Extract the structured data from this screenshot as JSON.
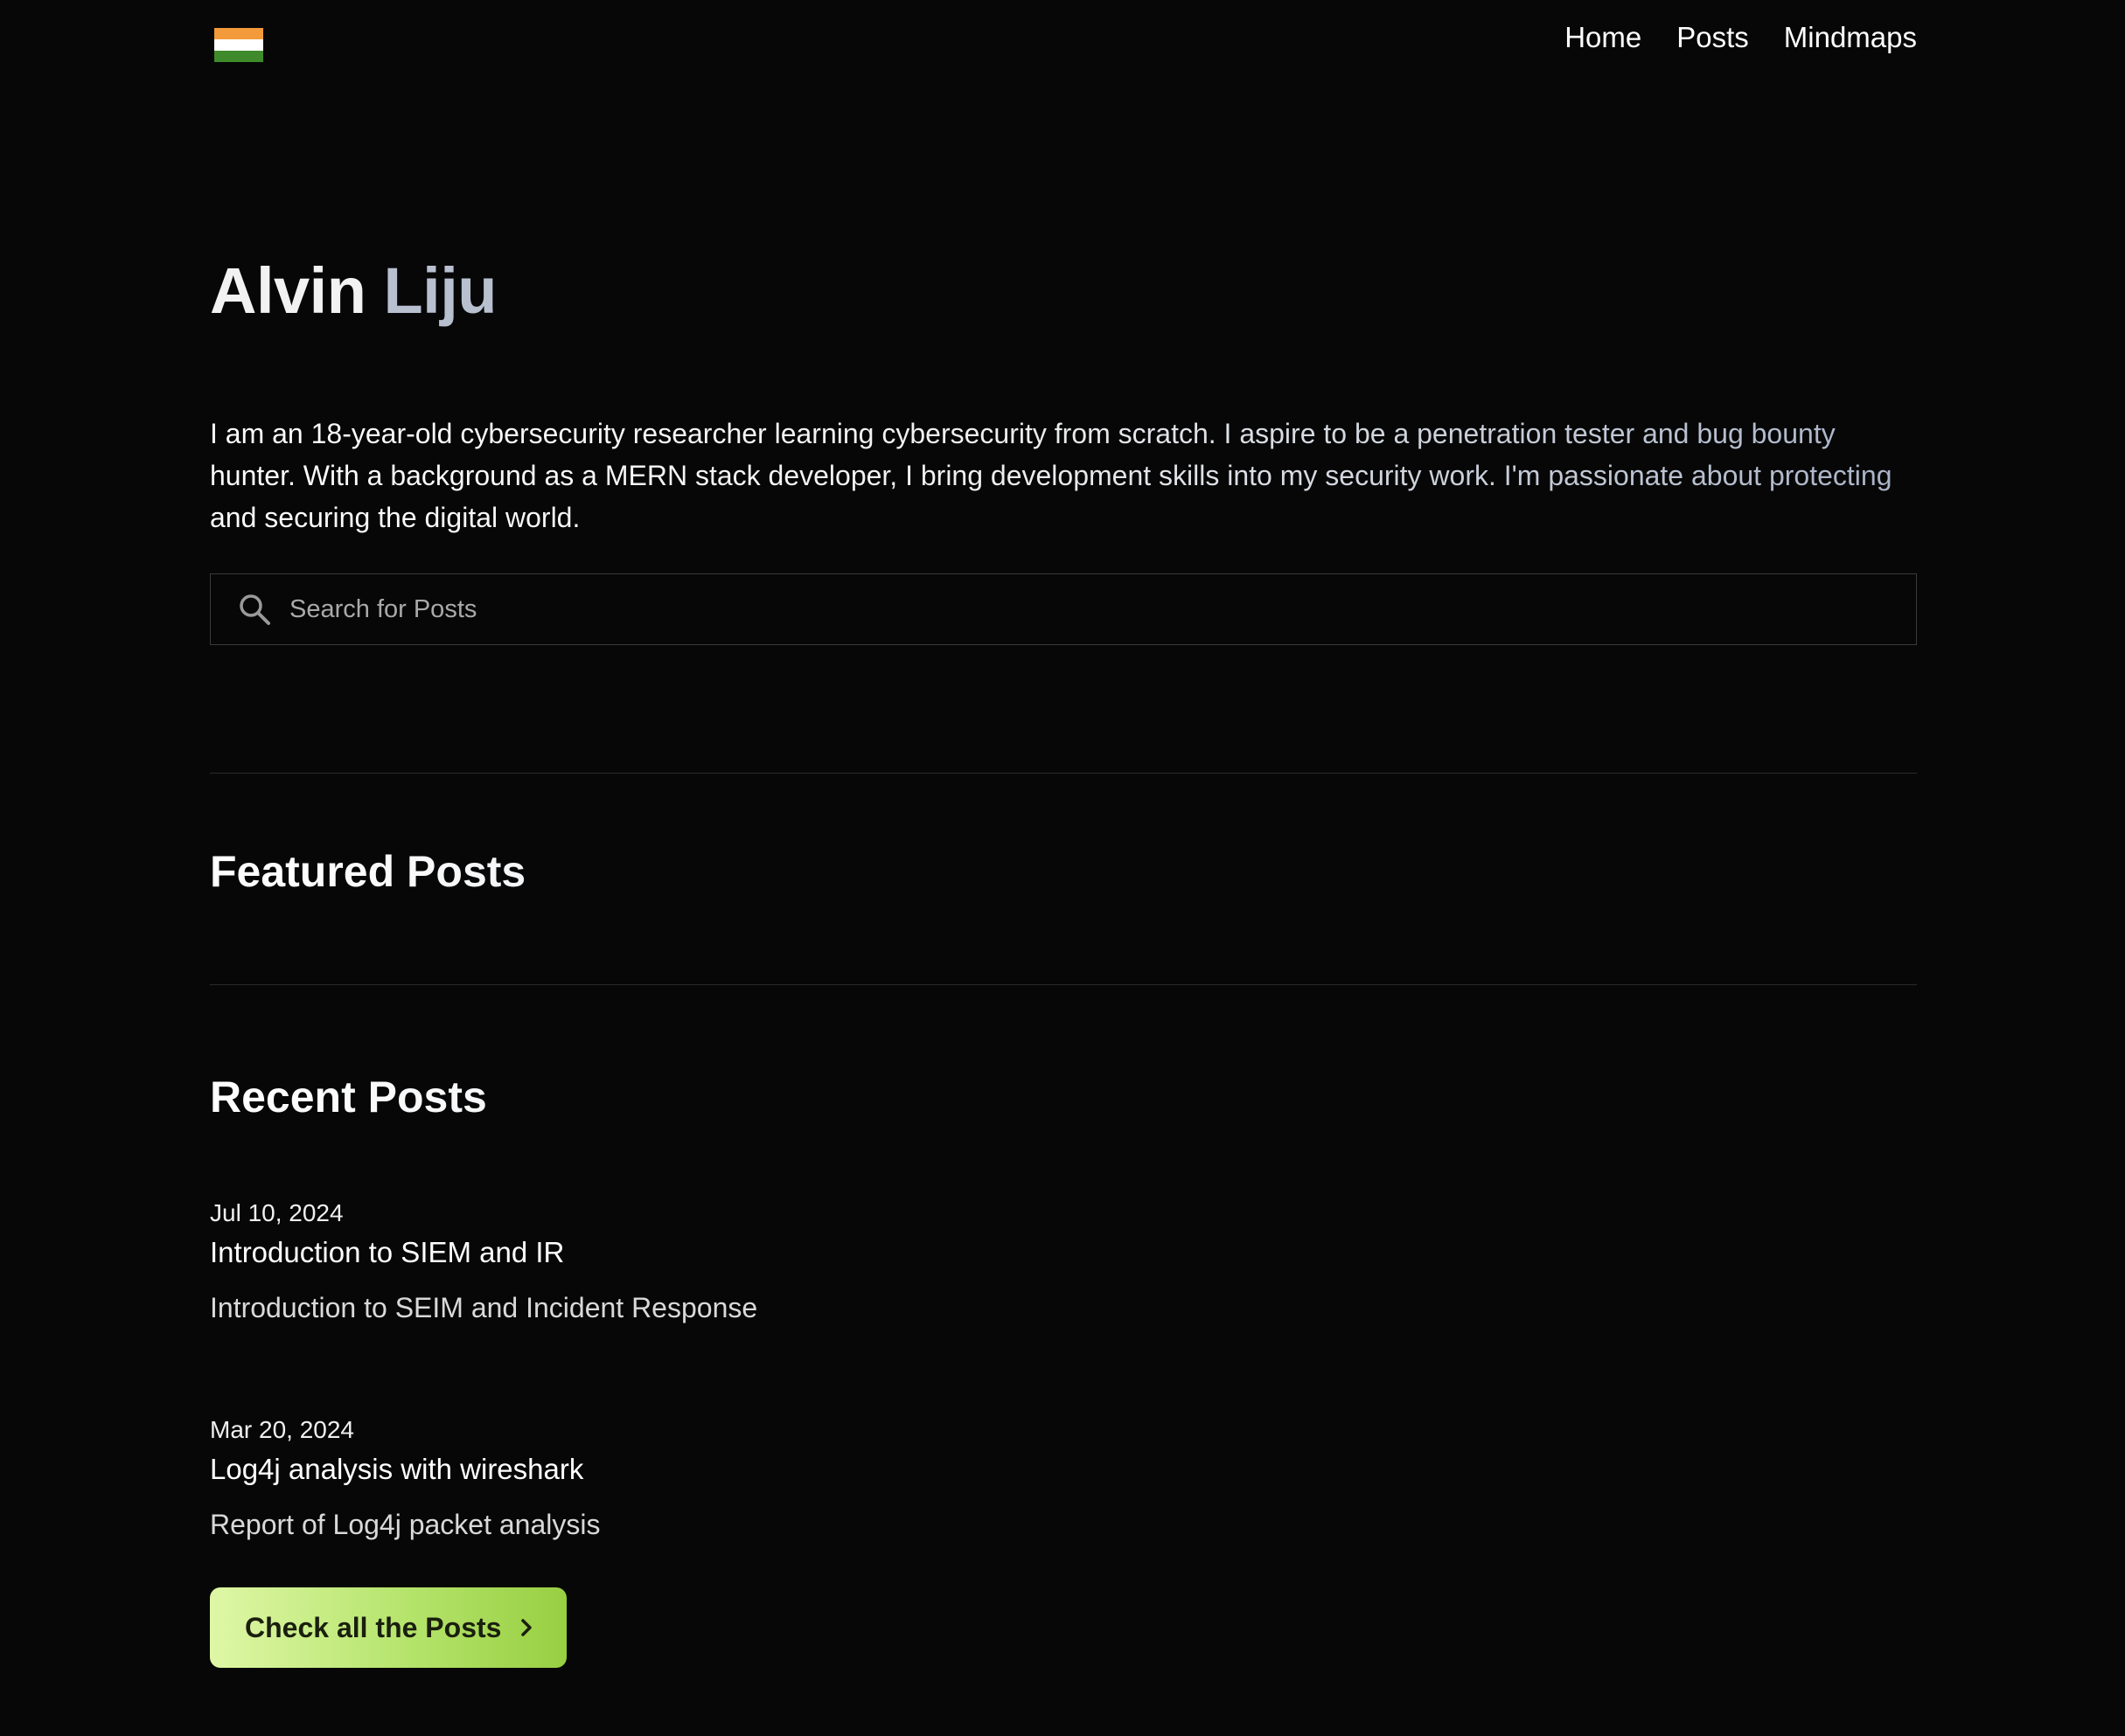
{
  "nav": {
    "links": [
      "Home",
      "Posts",
      "Mindmaps"
    ]
  },
  "flag_colors": {
    "top": "#f39a3b",
    "middle": "#ffffff",
    "bottom": "#3f8a2a"
  },
  "hero": {
    "first_name": "Alvin",
    "last_name": "Liju",
    "bio": "I am an 18-year-old cybersecurity researcher learning cybersecurity from scratch. I aspire to be a penetration tester and bug bounty hunter. With a background as a MERN stack developer, I bring development skills into my security work. I'm passionate about protecting and securing the digital world."
  },
  "search": {
    "placeholder": "Search for Posts",
    "icon": "search-icon"
  },
  "featured": {
    "title": "Featured Posts"
  },
  "recent": {
    "title": "Recent Posts",
    "posts": [
      {
        "date": "Jul 10, 2024",
        "title": "Introduction to SIEM and IR",
        "description": "Introduction to SEIM and Incident Response"
      },
      {
        "date": "Mar 20, 2024",
        "title": "Log4j analysis with wireshark",
        "description": "Report of Log4j packet analysis"
      }
    ]
  },
  "cta": {
    "label": "Check all the Posts",
    "icon": "chevron-right-icon",
    "accent": "#b5e46c"
  }
}
